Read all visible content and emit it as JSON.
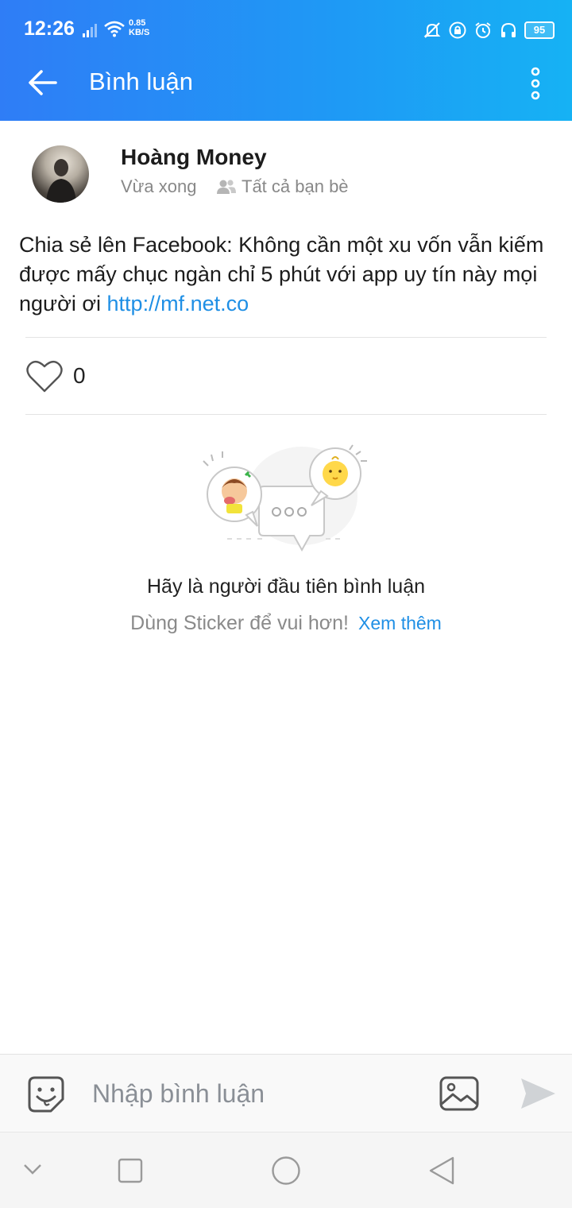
{
  "status_bar": {
    "time": "12:26",
    "net_speed_value": "0.85",
    "net_speed_unit": "KB/S",
    "battery": "95",
    "icons": [
      "signal-icon",
      "wifi-icon",
      "mute-icon",
      "lock-rotation-icon",
      "alarm-icon",
      "headphones-icon",
      "battery-icon"
    ]
  },
  "appbar": {
    "title": "Bình luận",
    "back_icon": "arrow-left-icon",
    "more_icon": "more-vertical-icon",
    "color_start": "#2f7df6",
    "color_end": "#16b2f4"
  },
  "post": {
    "author": "Hoàng Money",
    "time": "Vừa xong",
    "audience": "Tất cả bạn bè",
    "text": "Chia sẻ lên Facebook: Không cần một xu vốn vẫn kiếm được mấy chục ngàn chỉ 5 phút với app uy tín này mọi người ơi ",
    "link": "http://mf.net.co",
    "link_color": "#1f8fe5"
  },
  "reactions": {
    "like_count": "0",
    "like_icon": "heart-outline-icon"
  },
  "empty_state": {
    "title": "Hãy là người đầu tiên bình luận",
    "subtitle": "Dùng Sticker để vui hơn!",
    "see_more": "Xem thêm"
  },
  "composer": {
    "placeholder": "Nhập bình luận",
    "sticker_icon": "sticker-smile-icon",
    "image_icon": "image-icon",
    "send_icon": "send-icon"
  },
  "navbar": {
    "icons": [
      "chevron-down-icon",
      "square-recent-icon",
      "circle-home-icon",
      "triangle-back-icon"
    ]
  }
}
